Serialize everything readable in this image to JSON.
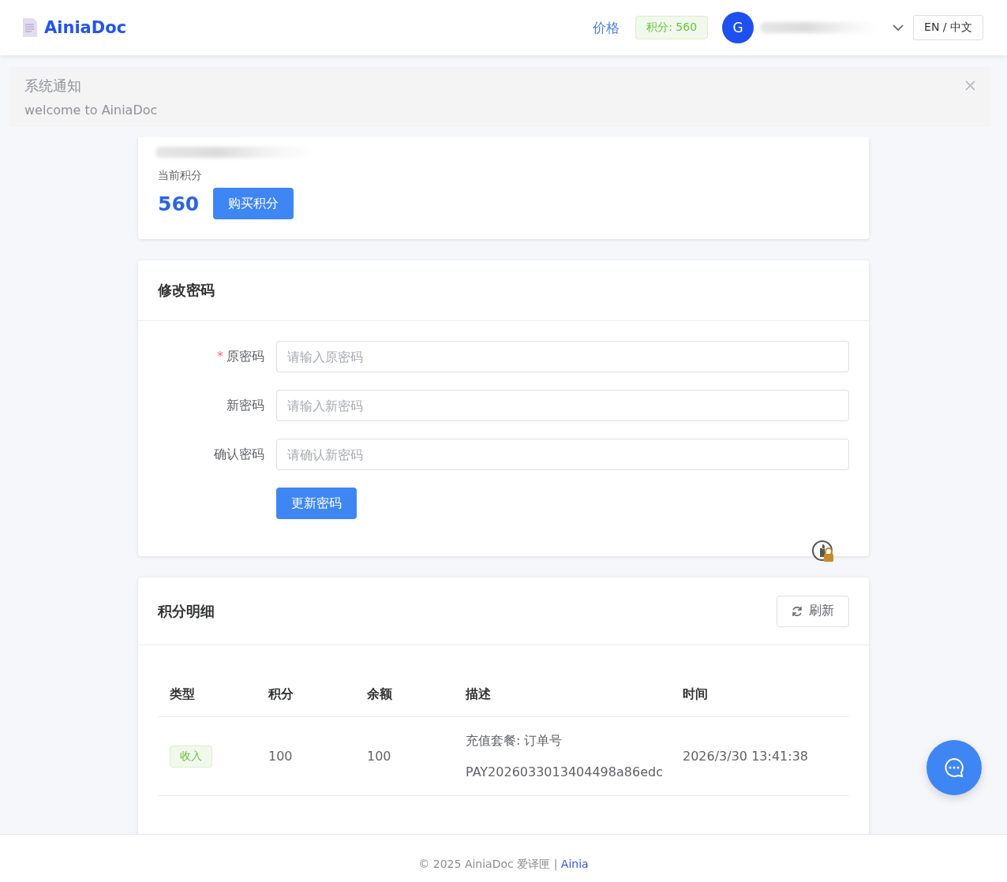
{
  "header": {
    "logo": "AiniaDoc",
    "nav_link": "价格",
    "points_badge": "积分: 560",
    "avatar": "G",
    "language": "EN / 中文"
  },
  "notice": {
    "title": "系统通知",
    "message": "welcome to AiniaDoc"
  },
  "points_card": {
    "label": "当前积分",
    "value": "560",
    "button": "购买积分"
  },
  "password_card": {
    "title": "修改密码",
    "required_mark": "*",
    "fields": [
      {
        "label": "原密码",
        "required": true,
        "placeholder": "请输入原密码"
      },
      {
        "label": "新密码",
        "required": false,
        "placeholder": "请输入新密码"
      },
      {
        "label": "确认密码",
        "required": false,
        "placeholder": "请确认新密码"
      }
    ],
    "button": "更新密码"
  },
  "history_card": {
    "title": "积分明细",
    "refresh": "刷新",
    "columns": [
      "类型",
      "积分",
      "余额",
      "描述",
      "时间"
    ],
    "rows": [
      {
        "type": "收入",
        "points": "100",
        "balance": "100",
        "description": [
          "充值套餐: 订单号",
          "PAY2026033013404498a86edc"
        ],
        "time": "2026/3/30 13:41:38"
      }
    ]
  },
  "footer": {
    "text": "© 2025 AiniaDoc 爱译匣 | ",
    "link": "Ainia"
  }
}
